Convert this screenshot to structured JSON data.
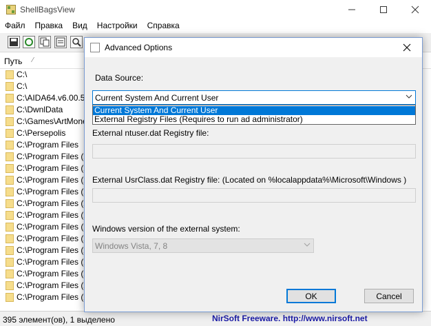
{
  "window": {
    "title": "ShellBagsView",
    "minimize": "—",
    "maximize": "☐",
    "close": "✕"
  },
  "menu": [
    "Файл",
    "Правка",
    "Вид",
    "Настройки",
    "Справка"
  ],
  "list": {
    "column_header": "Путь",
    "sort_indicator": "⁄",
    "rows": [
      "C:\\",
      "C:\\",
      "C:\\AIDA64.v6.00.51",
      "C:\\DwnlData",
      "C:\\Games\\ArtMoney",
      "C:\\Persepolis",
      "C:\\Program Files",
      "C:\\Program Files (x8",
      "C:\\Program Files (x8",
      "C:\\Program Files (x8",
      "C:\\Program Files (x8",
      "C:\\Program Files (x8",
      "C:\\Program Files (x8",
      "C:\\Program Files (x8",
      "C:\\Program Files (x8",
      "C:\\Program Files (x8",
      "C:\\Program Files (x8",
      "C:\\Program Files (x8",
      "C:\\Program Files (x8",
      "C:\\Program Files (x8"
    ]
  },
  "status": {
    "count": "395 элемент(ов), 1 выделено",
    "brand": "NirSoft Freeware.  http://www.nirsoft.net"
  },
  "dialog": {
    "title": "Advanced Options",
    "close": "✕",
    "data_source_label": "Data Source:",
    "data_source_value": "Current System And Current User",
    "data_source_options": [
      "Current System And Current User",
      "External Registry Files (Requires to run ad administrator)"
    ],
    "ntuser_label": "External ntuser.dat Registry file:",
    "ntuser_value": "",
    "usrclass_label": "External UsrClass.dat Registry file: (Located on %localappdata%\\Microsoft\\Windows )",
    "usrclass_value": "",
    "winver_label": "Windows version of the external system:",
    "winver_value": "Windows Vista, 7, 8",
    "ok_label": "OK",
    "cancel_label": "Cancel"
  },
  "colors": {
    "accent": "#0078d7",
    "brand_text": "#1a1aa6",
    "folder": "#f6dd8c"
  }
}
